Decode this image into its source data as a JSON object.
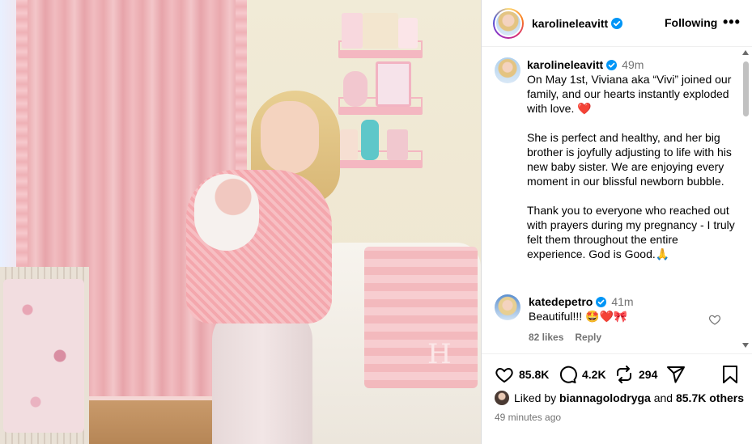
{
  "post": {
    "author": {
      "username": "karolineleavitt",
      "verified": true
    },
    "following_label": "Following",
    "more_label": "•••",
    "caption": {
      "username": "karolineleavitt",
      "time": "49m",
      "text": "On May 1st, Viviana aka “Vivi” joined our family, and our hearts instantly exploded with love. ❤️\n\nShe is perfect and healthy, and her big brother is joyfully adjusting to life with his new baby sister. We are enjoying every moment in our blissful newborn bubble.\n\nThank you to everyone who reached out with prayers during my pregnancy - I truly felt them throughout the entire experience. God is Good.🙏"
    },
    "comments": [
      {
        "username": "katedepetro",
        "verified": true,
        "time": "41m",
        "text": "Beautiful!!! 🤩❤️🎀",
        "likes": "82 likes",
        "reply_label": "Reply"
      }
    ],
    "actions": {
      "like_count": "85.8K",
      "comment_count": "4.2K",
      "repost_count": "294"
    },
    "liked_by": {
      "prefix": "Liked by",
      "user": "biannagolodryga",
      "joiner": "and",
      "others": "85.7K others"
    },
    "timestamp": "49 minutes ago"
  },
  "colors": {
    "verified_blue": "#0095f6",
    "muted_text": "#737373",
    "divider": "#efefef"
  },
  "icons": [
    "verified-icon",
    "heart-icon",
    "comment-icon",
    "repost-icon",
    "share-icon",
    "bookmark-icon",
    "more-icon"
  ]
}
